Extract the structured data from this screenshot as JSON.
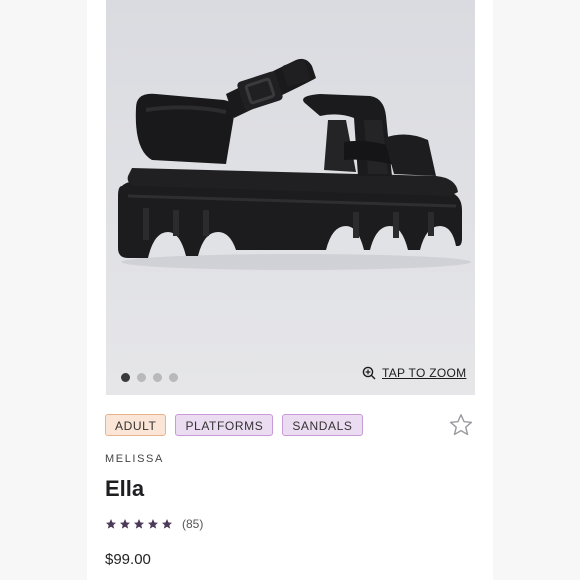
{
  "product": {
    "image": {
      "carousel_total": 4,
      "carousel_active_index": 0
    },
    "zoom_label": "TAP TO ZOOM",
    "tags": [
      "ADULT",
      "PLATFORMS",
      "SANDALS"
    ],
    "brand": "MELISSA",
    "name": "Ella",
    "rating": {
      "stars": 5,
      "count_label": "(85)"
    },
    "price": "$99.00",
    "icons": {
      "zoom": "magnify-plus-icon",
      "favorite": "star-outline-icon",
      "rating_star": "star-filled-icon"
    }
  },
  "colors": {
    "accent_purple": "#4a3a57",
    "tag_adult_bg": "#fbe5d6",
    "tag_category_bg": "#ecdcf2",
    "image_bg": "#dfe0e4"
  }
}
